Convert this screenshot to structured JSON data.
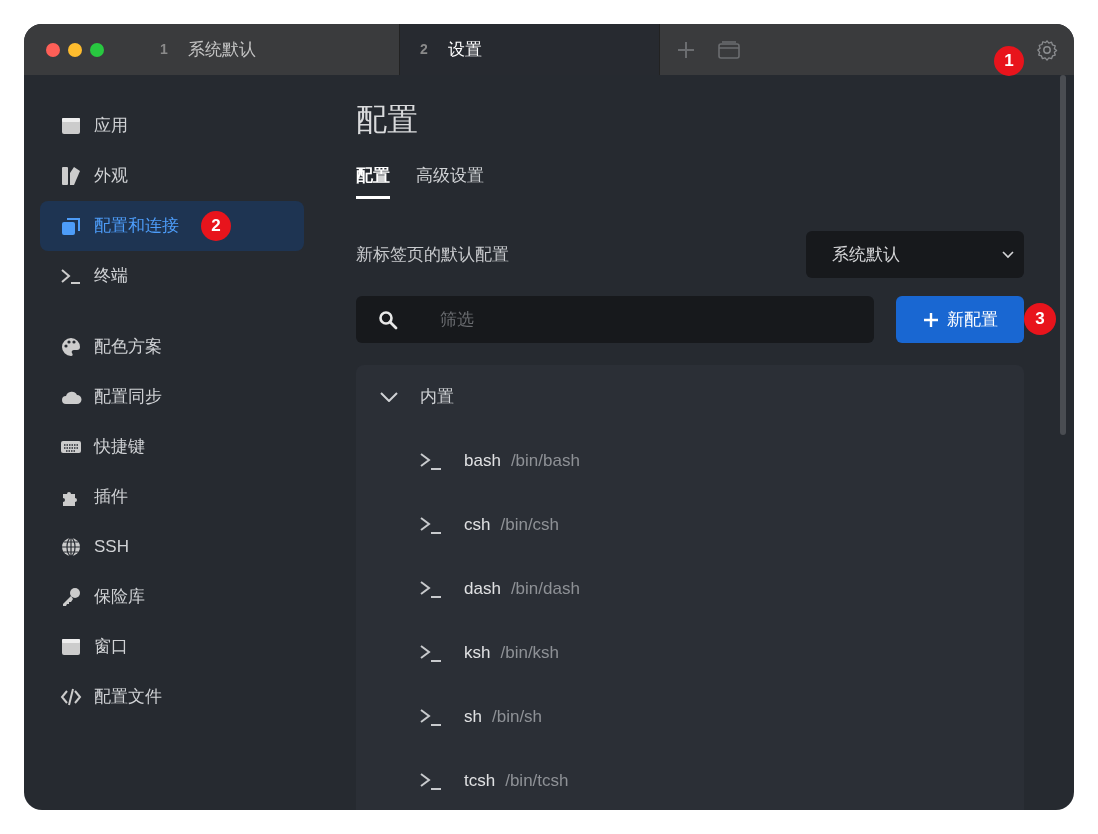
{
  "tabs": [
    {
      "number": "1",
      "label": "系统默认",
      "selected": false
    },
    {
      "number": "2",
      "label": "设置",
      "selected": true
    }
  ],
  "titlebar_badge": "1",
  "sidebar": {
    "sections": [
      [
        {
          "label": "应用",
          "selected": false
        },
        {
          "label": "外观",
          "selected": false
        },
        {
          "label": "配置和连接",
          "selected": true,
          "badge": "2"
        },
        {
          "label": "终端",
          "selected": false
        }
      ],
      [
        {
          "label": "配色方案",
          "selected": false
        },
        {
          "label": "配置同步",
          "selected": false
        },
        {
          "label": "快捷键",
          "selected": false
        },
        {
          "label": "插件",
          "selected": false
        },
        {
          "label": "SSH",
          "selected": false
        },
        {
          "label": "保险库",
          "selected": false
        },
        {
          "label": "窗口",
          "selected": false
        },
        {
          "label": "配置文件",
          "selected": false
        }
      ]
    ]
  },
  "page_title": "配置",
  "page_tabs": [
    {
      "label": "配置",
      "selected": true
    },
    {
      "label": "高级设置",
      "selected": false
    }
  ],
  "default_profile": {
    "label": "新标签页的默认配置",
    "value": "系统默认"
  },
  "filter": {
    "placeholder": "筛选"
  },
  "new_button": {
    "label": "新配置",
    "badge": "3"
  },
  "groups": [
    {
      "label": "内置",
      "expanded": true,
      "children": [
        {
          "name": "bash",
          "path": "/bin/bash"
        },
        {
          "name": "csh",
          "path": "/bin/csh"
        },
        {
          "name": "dash",
          "path": "/bin/dash"
        },
        {
          "name": "ksh",
          "path": "/bin/ksh"
        },
        {
          "name": "sh",
          "path": "/bin/sh"
        },
        {
          "name": "tcsh",
          "path": "/bin/tcsh"
        }
      ]
    }
  ]
}
